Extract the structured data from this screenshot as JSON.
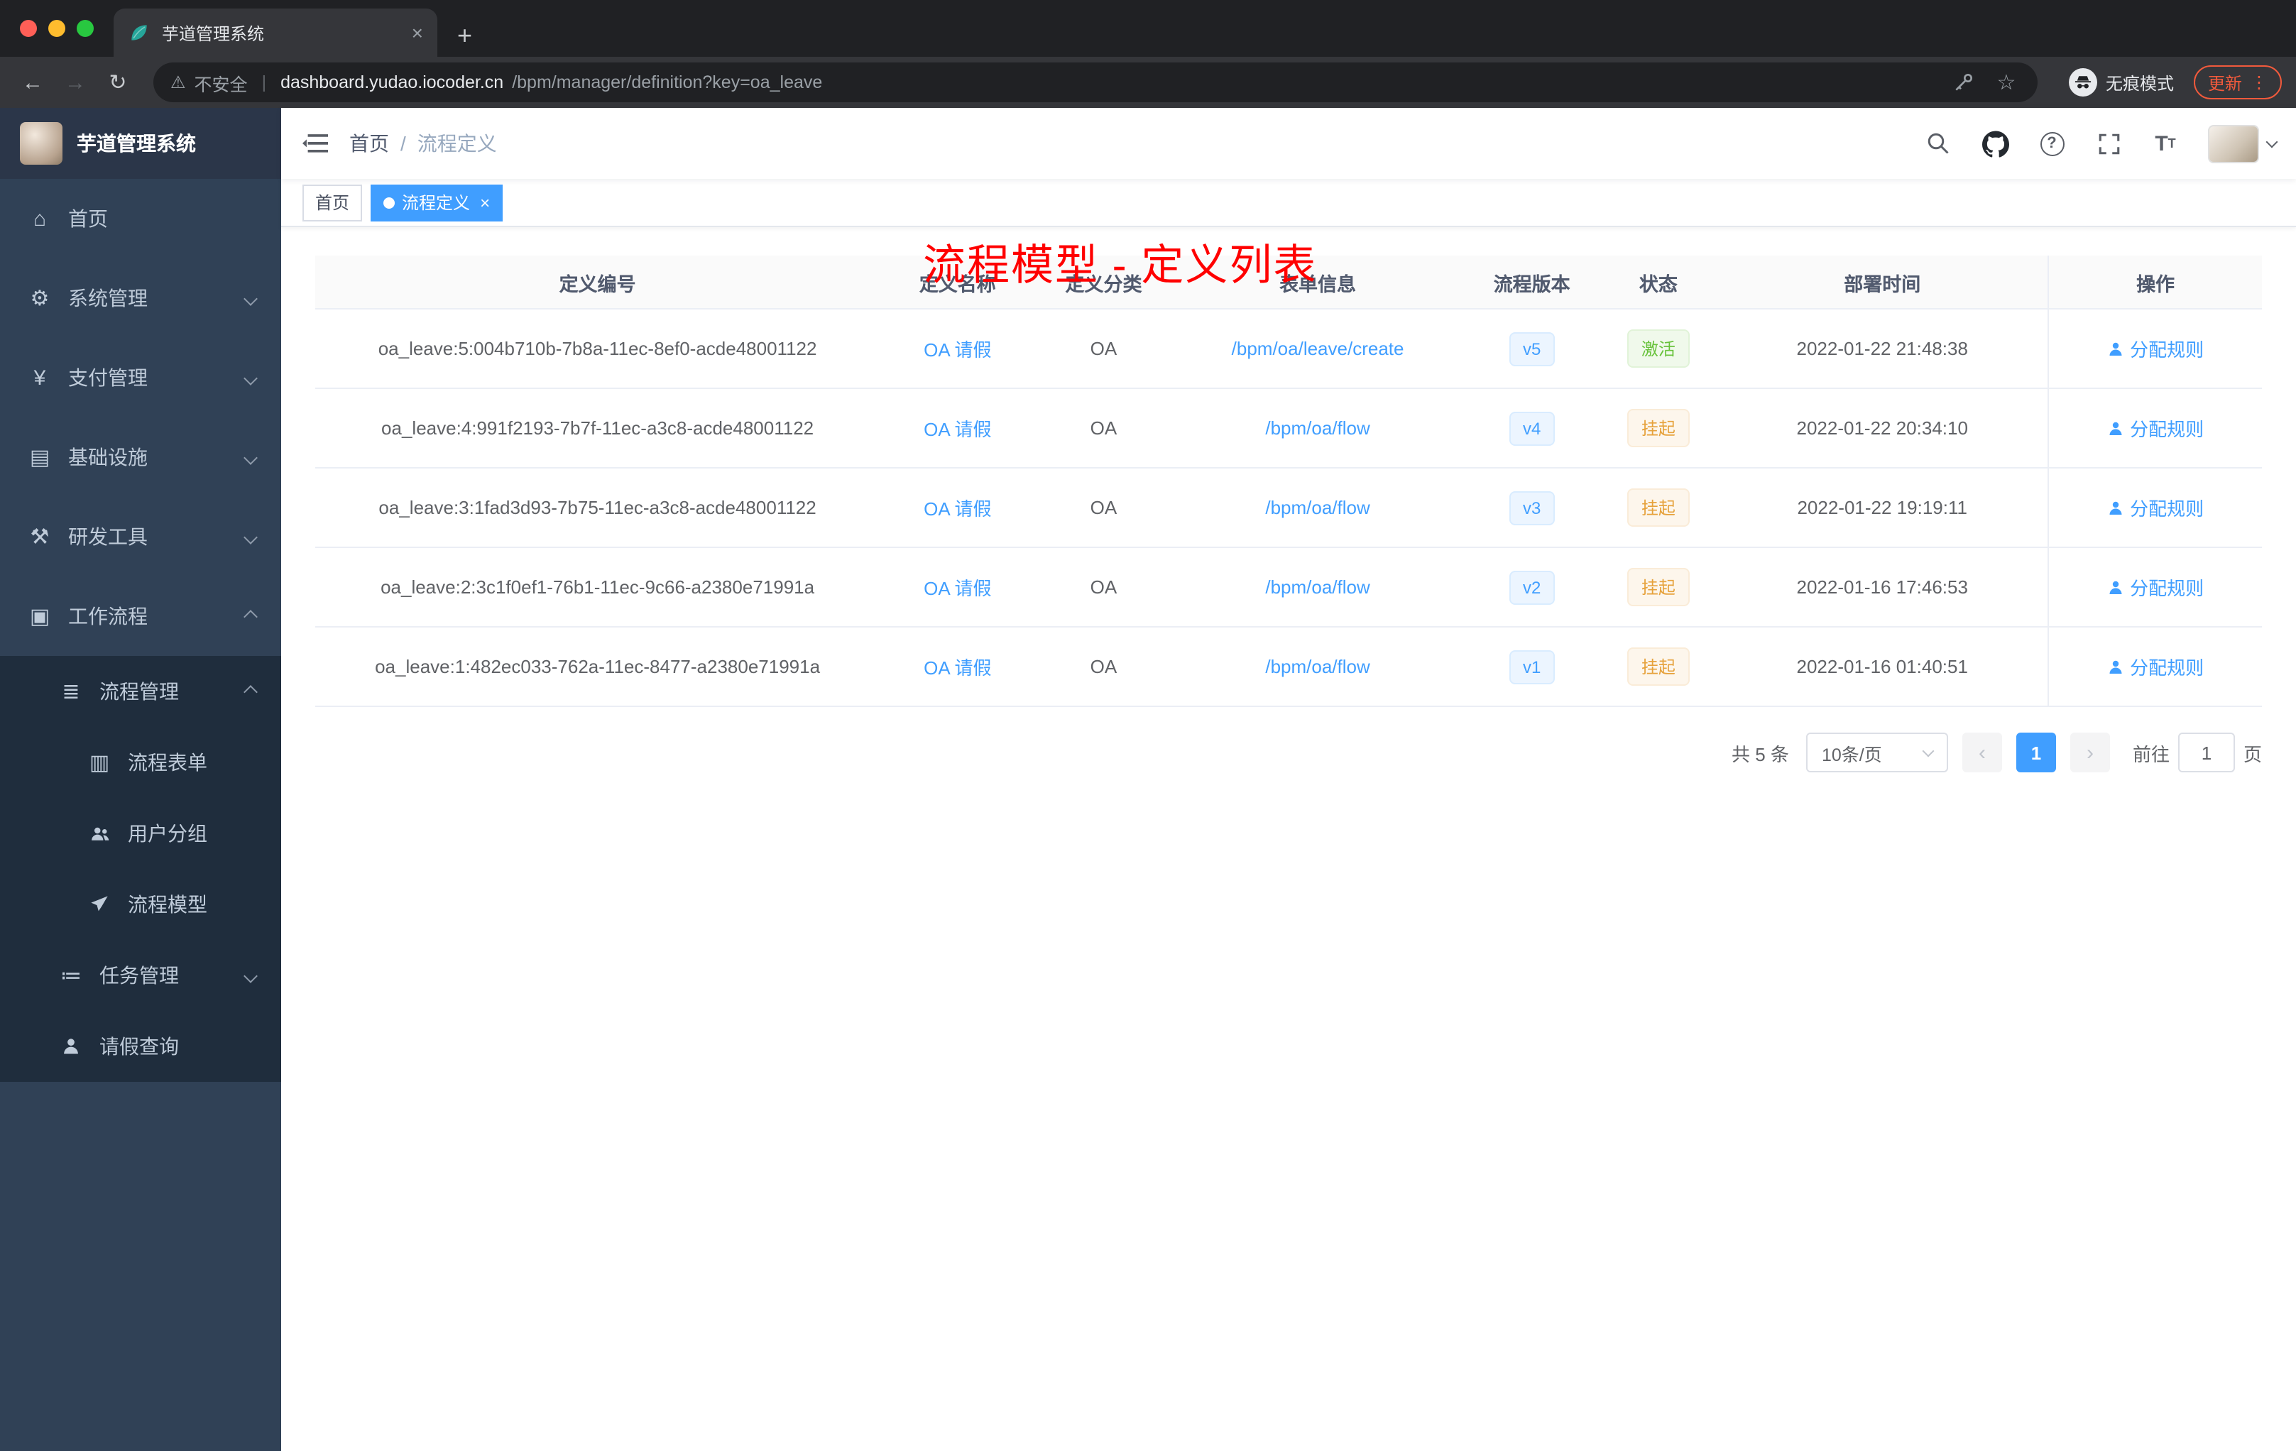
{
  "colors": {
    "accent": "#409eff",
    "annotation_red": "#ff0000",
    "status_active": "#67c23a",
    "status_suspended": "#e6a23c",
    "sidebar_bg": "#304156",
    "submenu_bg": "#1f2d3d",
    "update_pill": "#f25a3c"
  },
  "icons": {
    "back": "←",
    "forward": "→",
    "reload": "↻",
    "warning": "⚠",
    "pipe": "|",
    "star": "☆",
    "kebab": "⋮",
    "plus": "+",
    "close": "×",
    "prev": "‹",
    "next": "›",
    "question": "?"
  },
  "browser": {
    "tab_title": "芋道管理系统",
    "security_label": "不安全",
    "url_host": "dashboard.yudao.iocoder.cn",
    "url_path": "/bpm/manager/definition?key=oa_leave",
    "incognito_label": "无痕模式",
    "update_label": "更新"
  },
  "sidebar": {
    "logo_title": "芋道管理系统",
    "menu": [
      {
        "label": "首页",
        "icon_glyph": "⌂"
      },
      {
        "label": "系统管理",
        "icon_glyph": "⚙"
      },
      {
        "label": "支付管理",
        "icon_glyph": "¥"
      },
      {
        "label": "基础设施",
        "icon_glyph": "▤"
      },
      {
        "label": "研发工具",
        "icon_glyph": "⚒"
      },
      {
        "label": "工作流程",
        "icon_glyph": "▣"
      }
    ],
    "submenu": {
      "process_mgmt": {
        "label": "流程管理",
        "icon_glyph": "≣"
      },
      "children": [
        "流程表单",
        "用户分组",
        "流程模型"
      ],
      "task_mgmt": {
        "label": "任务管理",
        "icon_glyph": "≔"
      },
      "leave_query": {
        "label": "请假查询"
      }
    }
  },
  "navbar": {
    "breadcrumb": [
      "首页",
      "流程定义"
    ],
    "separator": "/",
    "annotation": "流程模型 - 定义列表"
  },
  "tags": {
    "home": "首页",
    "active": "流程定义",
    "close": "×"
  },
  "table": {
    "headers": [
      "定义编号",
      "定义名称",
      "定义分类",
      "表单信息",
      "流程版本",
      "状态",
      "部署时间",
      "操作"
    ],
    "rows": [
      {
        "id": "oa_leave:5:004b710b-7b8a-11ec-8ef0-acde48001122",
        "name": "OA 请假",
        "category": "OA",
        "form": "/bpm/oa/leave/create",
        "version": "v5",
        "status": "激活",
        "time": "2022-01-22 21:48:38",
        "action": "分配规则"
      },
      {
        "id": "oa_leave:4:991f2193-7b7f-11ec-a3c8-acde48001122",
        "name": "OA 请假",
        "category": "OA",
        "form": "/bpm/oa/flow",
        "version": "v4",
        "status": "挂起",
        "time": "2022-01-22 20:34:10",
        "action": "分配规则"
      },
      {
        "id": "oa_leave:3:1fad3d93-7b75-11ec-a3c8-acde48001122",
        "name": "OA 请假",
        "category": "OA",
        "form": "/bpm/oa/flow",
        "version": "v3",
        "status": "挂起",
        "time": "2022-01-22 19:19:11",
        "action": "分配规则"
      },
      {
        "id": "oa_leave:2:3c1f0ef1-76b1-11ec-9c66-a2380e71991a",
        "name": "OA 请假",
        "category": "OA",
        "form": "/bpm/oa/flow",
        "version": "v2",
        "status": "挂起",
        "time": "2022-01-16 17:46:53",
        "action": "分配规则"
      },
      {
        "id": "oa_leave:1:482ec033-762a-11ec-8477-a2380e71991a",
        "name": "OA 请假",
        "category": "OA",
        "form": "/bpm/oa/flow",
        "version": "v1",
        "status": "挂起",
        "time": "2022-01-16 01:40:51",
        "action": "分配规则"
      }
    ]
  },
  "pagination": {
    "total": "共 5 条",
    "page_size": "10条/页",
    "current_page": "1",
    "goto_label": "前往",
    "goto_value": "1",
    "goto_unit": "页"
  }
}
